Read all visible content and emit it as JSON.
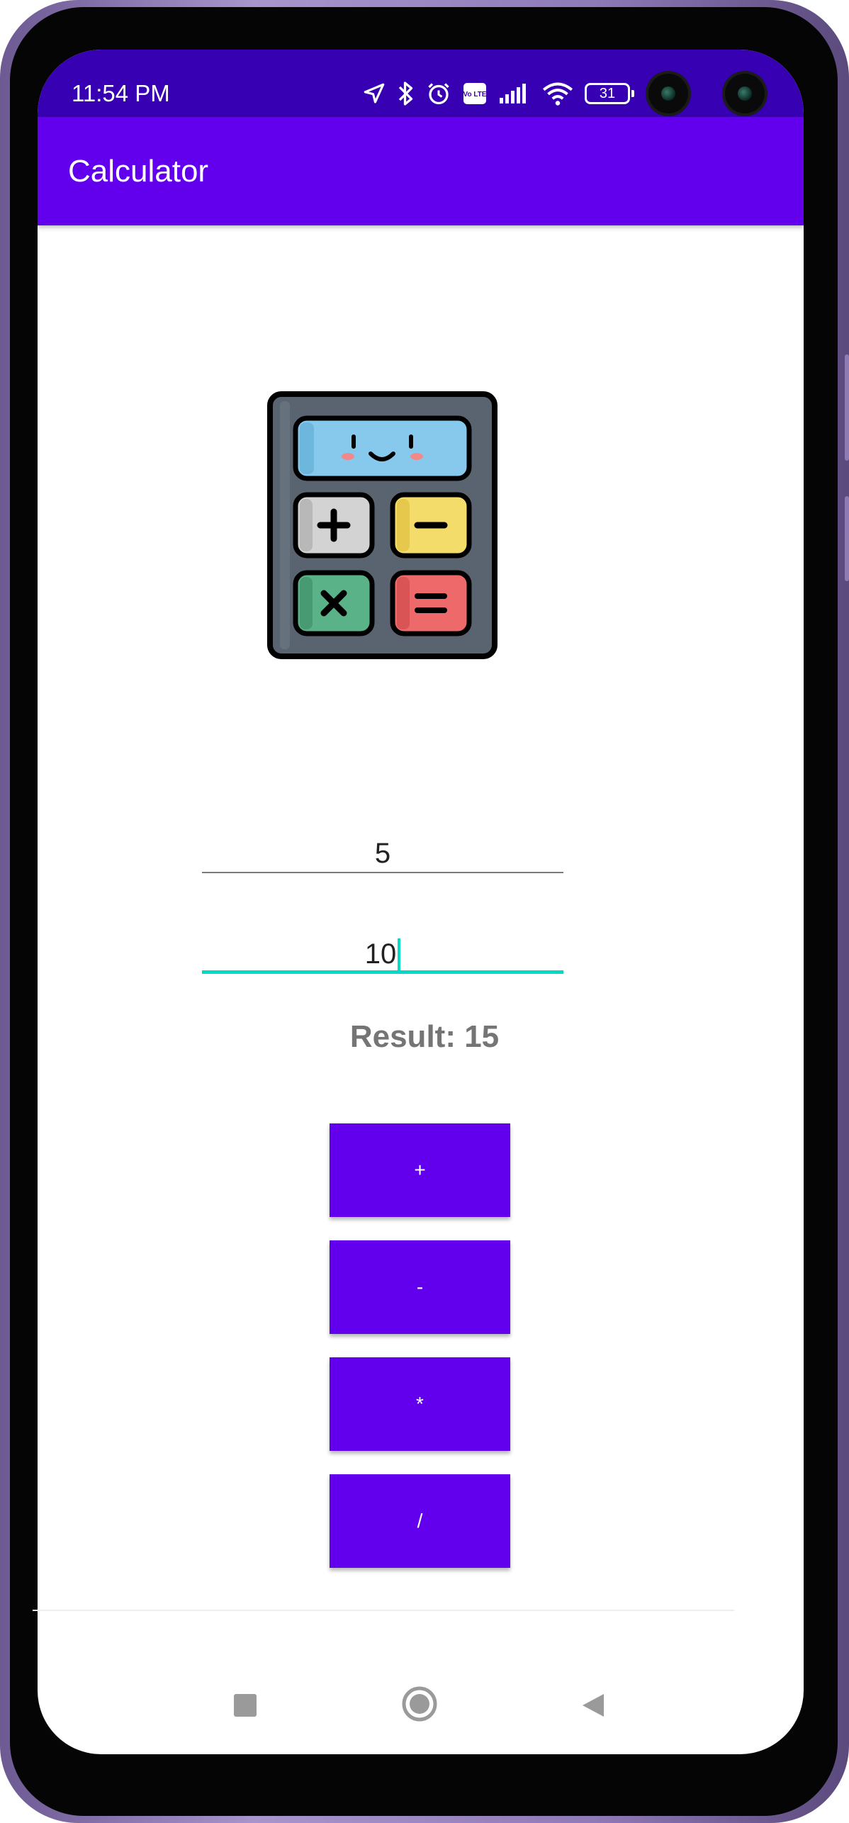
{
  "status_bar": {
    "time": "11:54 PM",
    "battery": "31",
    "volte_label": "Vo LTE",
    "icons": [
      "location-arrow-icon",
      "bluetooth-icon",
      "alarm-icon",
      "volte-icon",
      "signal-icon",
      "wifi-icon",
      "battery-icon"
    ]
  },
  "app_bar": {
    "title": "Calculator"
  },
  "illustration": {
    "icon": "calculator-icon"
  },
  "inputs": {
    "first_number": "5",
    "second_number": "10"
  },
  "result_text": "Result: 15",
  "buttons": {
    "add": "+",
    "subtract": "-",
    "multiply": "*",
    "divide": "/"
  },
  "nav_bar": {
    "icons": [
      "recents-square-icon",
      "home-circle-icon",
      "back-triangle-icon"
    ]
  },
  "colors": {
    "primary": "#6200ee",
    "primary_dark": "#3700b3",
    "accent": "#03dac5",
    "result_text": "#757575"
  }
}
